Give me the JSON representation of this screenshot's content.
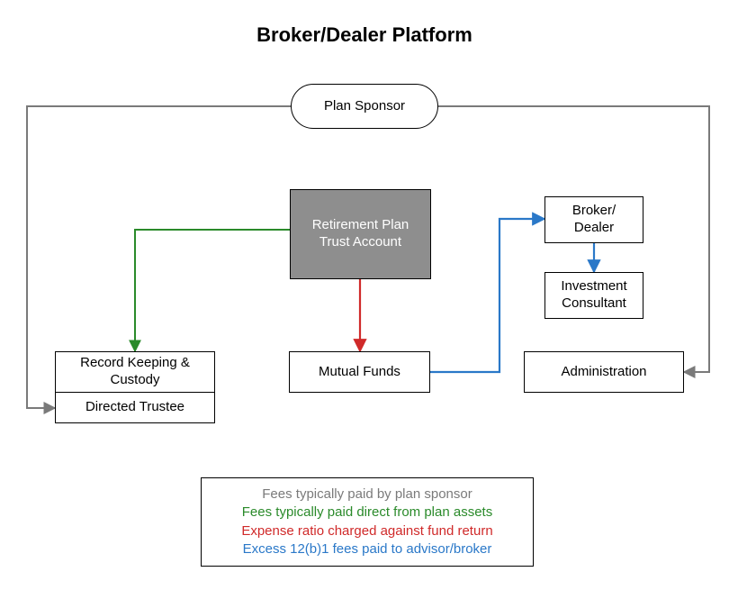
{
  "title": "Broker/Dealer Platform",
  "nodes": {
    "planSponsor": "Plan Sponsor",
    "trustAccount": "Retirement Plan Trust Account",
    "brokerDealer": "Broker/ Dealer",
    "investmentConsultant": "Investment Consultant",
    "recordKeeping": "Record Keeping & Custody",
    "directedTrustee": "Directed Trustee",
    "mutualFunds": "Mutual Funds",
    "administration": "Administration"
  },
  "legend": {
    "line1": "Fees typically paid by plan sponsor",
    "line2": "Fees typically paid direct from plan assets",
    "line3": "Expense ratio charged against fund return",
    "line4": "Excess 12(b)1 fees paid to advisor/broker"
  },
  "colors": {
    "sponsor": "#7a7a7a",
    "assets": "#2a8a2a",
    "expense": "#d02a2a",
    "twelveb1": "#2a78c8"
  }
}
